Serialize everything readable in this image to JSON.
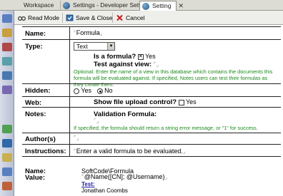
{
  "tabs": [
    {
      "label": "Workspace"
    },
    {
      "label": "Settings - Developer Settings"
    },
    {
      "label": "Setting"
    }
  ],
  "tab_close_glyph": "✕",
  "toolbar": {
    "read_mode_label": "Read Mode",
    "save_close_label": "Save & Close",
    "cancel_label": "Cancel"
  },
  "form": {
    "name_label": "Name:",
    "name_value": "Formula",
    "type_label": "Type:",
    "type_selected": "Text",
    "is_formula_label": "Is a formula?",
    "is_formula_checked": true,
    "is_formula_value": "Yes",
    "test_view_label": "Test against view:",
    "test_view_help": "Optional. Enter the name of a view in this database which contains the documents this formula will be evaluated against. If specified, Notes users can test their formulas as they create them.",
    "hidden_label": "Hidden:",
    "hidden_options": [
      "Yes",
      "No"
    ],
    "hidden_selected": "No",
    "web_label": "Web:",
    "upload_label": "Show file upload control?",
    "upload_value": "Yes",
    "notes_label": "Notes:",
    "validation_label": "Validation Formula:",
    "validation_help": "If specified, the formula should return a string error message, or \"1\" for success.",
    "authors_label": "Author(s)",
    "instructions_label": "Instructions:",
    "instructions_value": "Enter a valid formula to be evaluated."
  },
  "summary": {
    "name_label": "Name:",
    "name_value": "SoftCode\\Formula",
    "value_label": "Value:",
    "value_value": "@Name([CN]; @Username)",
    "test_link": "Test:",
    "result": "Jonathan Coombs"
  }
}
